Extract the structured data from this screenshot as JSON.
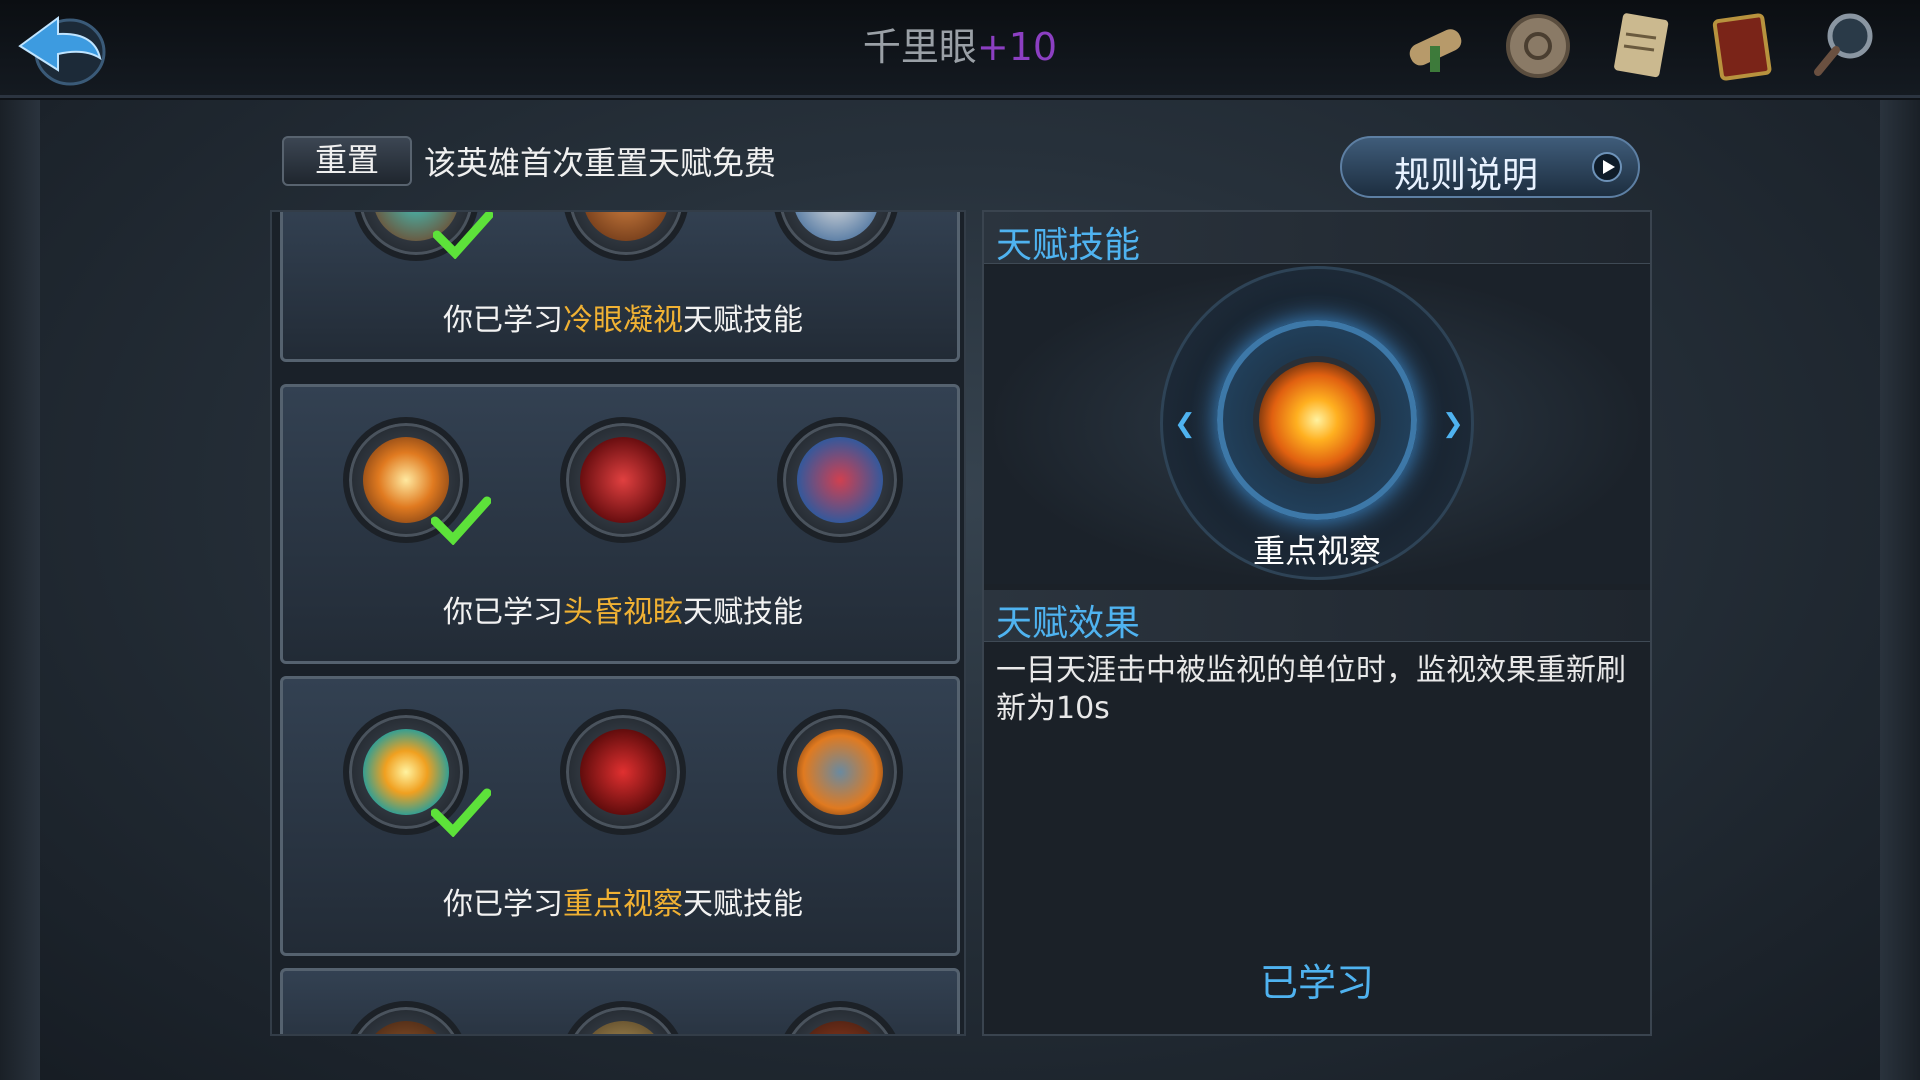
{
  "header": {
    "title": "千里眼",
    "title_plus": "+10",
    "icons": [
      "scroll-icon",
      "rune-icon",
      "map-icon",
      "book-icon",
      "magnifier-icon"
    ]
  },
  "controls": {
    "reset_label": "重置",
    "reset_note": "该英雄首次重置天赋免费",
    "rules_label": "规则说明"
  },
  "tiers": [
    {
      "prefix": "你已学习",
      "talent": "冷眼凝视",
      "suffix": "天赋技能"
    },
    {
      "prefix": "你已学习",
      "talent": "头昏视眩",
      "suffix": "天赋技能"
    },
    {
      "prefix": "你已学习",
      "talent": "重点视察",
      "suffix": "天赋技能"
    }
  ],
  "detail": {
    "skill_header": "天赋技能",
    "skill_name": "重点视察",
    "effect_header": "天赋效果",
    "effect_text": "一目天涯击中被监视的单位时，监视效果重新刷新为10s",
    "status": "已学习"
  },
  "colors": {
    "highlight": "#f0b133",
    "accent_blue": "#4fb3f0",
    "plus_purple": "#8c3fc2"
  }
}
